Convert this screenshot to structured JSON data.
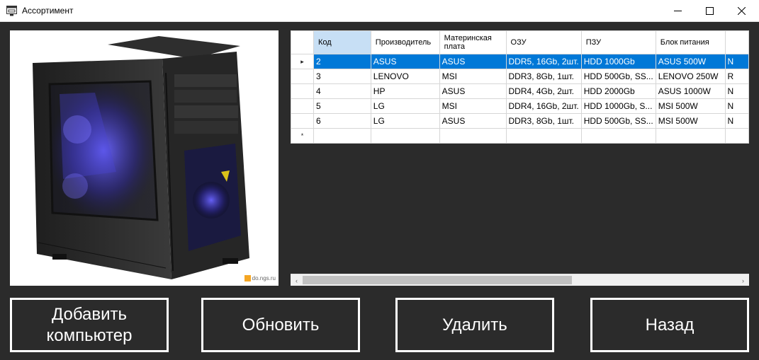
{
  "window": {
    "title": "Ассортимент",
    "controls": [
      "minimize",
      "maximize",
      "close"
    ]
  },
  "image": {
    "subject": "PC tower case",
    "watermark": "do.ngs.ru"
  },
  "grid": {
    "columns": [
      "Код",
      "Производитель",
      "Материнская плата",
      "ОЗУ",
      "ПЗУ",
      "Блок питания",
      ""
    ],
    "rows": [
      [
        "2",
        "ASUS",
        "ASUS",
        "DDR5, 16Gb, 2шт.",
        "HDD 1000Gb",
        "ASUS 500W",
        "N"
      ],
      [
        "3",
        "LENOVO",
        "MSI",
        "DDR3, 8Gb, 1шт.",
        "HDD 500Gb, SS...",
        "LENOVO 250W",
        "R"
      ],
      [
        "4",
        "HP",
        "ASUS",
        "DDR4, 4Gb, 2шт.",
        "HDD 2000Gb",
        "ASUS 1000W",
        "N"
      ],
      [
        "5",
        "LG",
        "MSI",
        "DDR4, 16Gb, 2шт.",
        "HDD 1000Gb, S...",
        "MSI 500W",
        "N"
      ],
      [
        "6",
        "LG",
        "ASUS",
        "DDR3, 8Gb, 1шт.",
        "HDD 500Gb, SS...",
        "MSI 500W",
        "N"
      ]
    ],
    "selected_row_index": 0,
    "current_row_marker": "▸",
    "new_row_marker": "*",
    "selection_color": "#0078d7"
  },
  "scrollbar": {
    "left_arrow": "‹",
    "right_arrow": "›"
  },
  "buttons": {
    "add_line1": "Добавить",
    "add_line2": "компьютер",
    "refresh": "Обновить",
    "delete": "Удалить",
    "back": "Назад"
  }
}
